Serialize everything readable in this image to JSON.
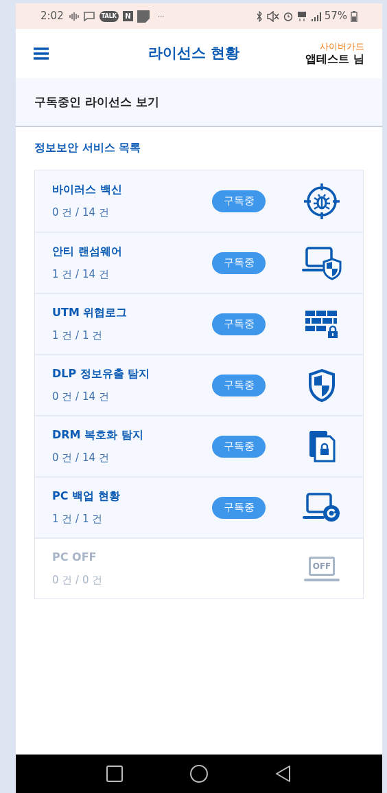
{
  "status_bar": {
    "time": "2:02",
    "notifications": [
      {
        "kind": "voice"
      },
      {
        "kind": "message"
      },
      {
        "kind": "talk",
        "label": "TALK"
      },
      {
        "kind": "naver",
        "label": "N"
      },
      {
        "kind": "note"
      }
    ],
    "more": "···",
    "battery_text": "57%"
  },
  "header": {
    "title": "라이선스 현황",
    "brand": "사이버가드",
    "user": "앱테스트 님"
  },
  "section": {
    "title": "구독중인 라이선스 보기"
  },
  "list": {
    "title": "정보보안 서비스 목록",
    "items": [
      {
        "name": "바이러스 백신",
        "count": "0 건 / 14 건",
        "badge": "구독중",
        "kind": "bug",
        "disabled": false
      },
      {
        "name": "안티 랜섬웨어",
        "count": "1 건 / 14 건",
        "badge": "구독중",
        "kind": "laptop-shield",
        "disabled": false
      },
      {
        "name": "UTM 위협로그",
        "count": "1 건 / 1 건",
        "badge": "구독중",
        "kind": "wall",
        "disabled": false
      },
      {
        "name": "DLP 정보유출 탐지",
        "count": "0 건 / 14 건",
        "badge": "구독중",
        "kind": "shield",
        "disabled": false
      },
      {
        "name": "DRM 복호화 탐지",
        "count": "0 건 / 14 건",
        "badge": "구독중",
        "kind": "doc-lock",
        "disabled": false
      },
      {
        "name": "PC 백업 현황",
        "count": "1 건 / 1 건",
        "badge": "구독중",
        "kind": "laptop-refresh",
        "disabled": false
      },
      {
        "name": "PC OFF",
        "count": "0 건 / 0 건",
        "kind": "laptop-off",
        "label": "OFF",
        "disabled": true
      }
    ]
  }
}
